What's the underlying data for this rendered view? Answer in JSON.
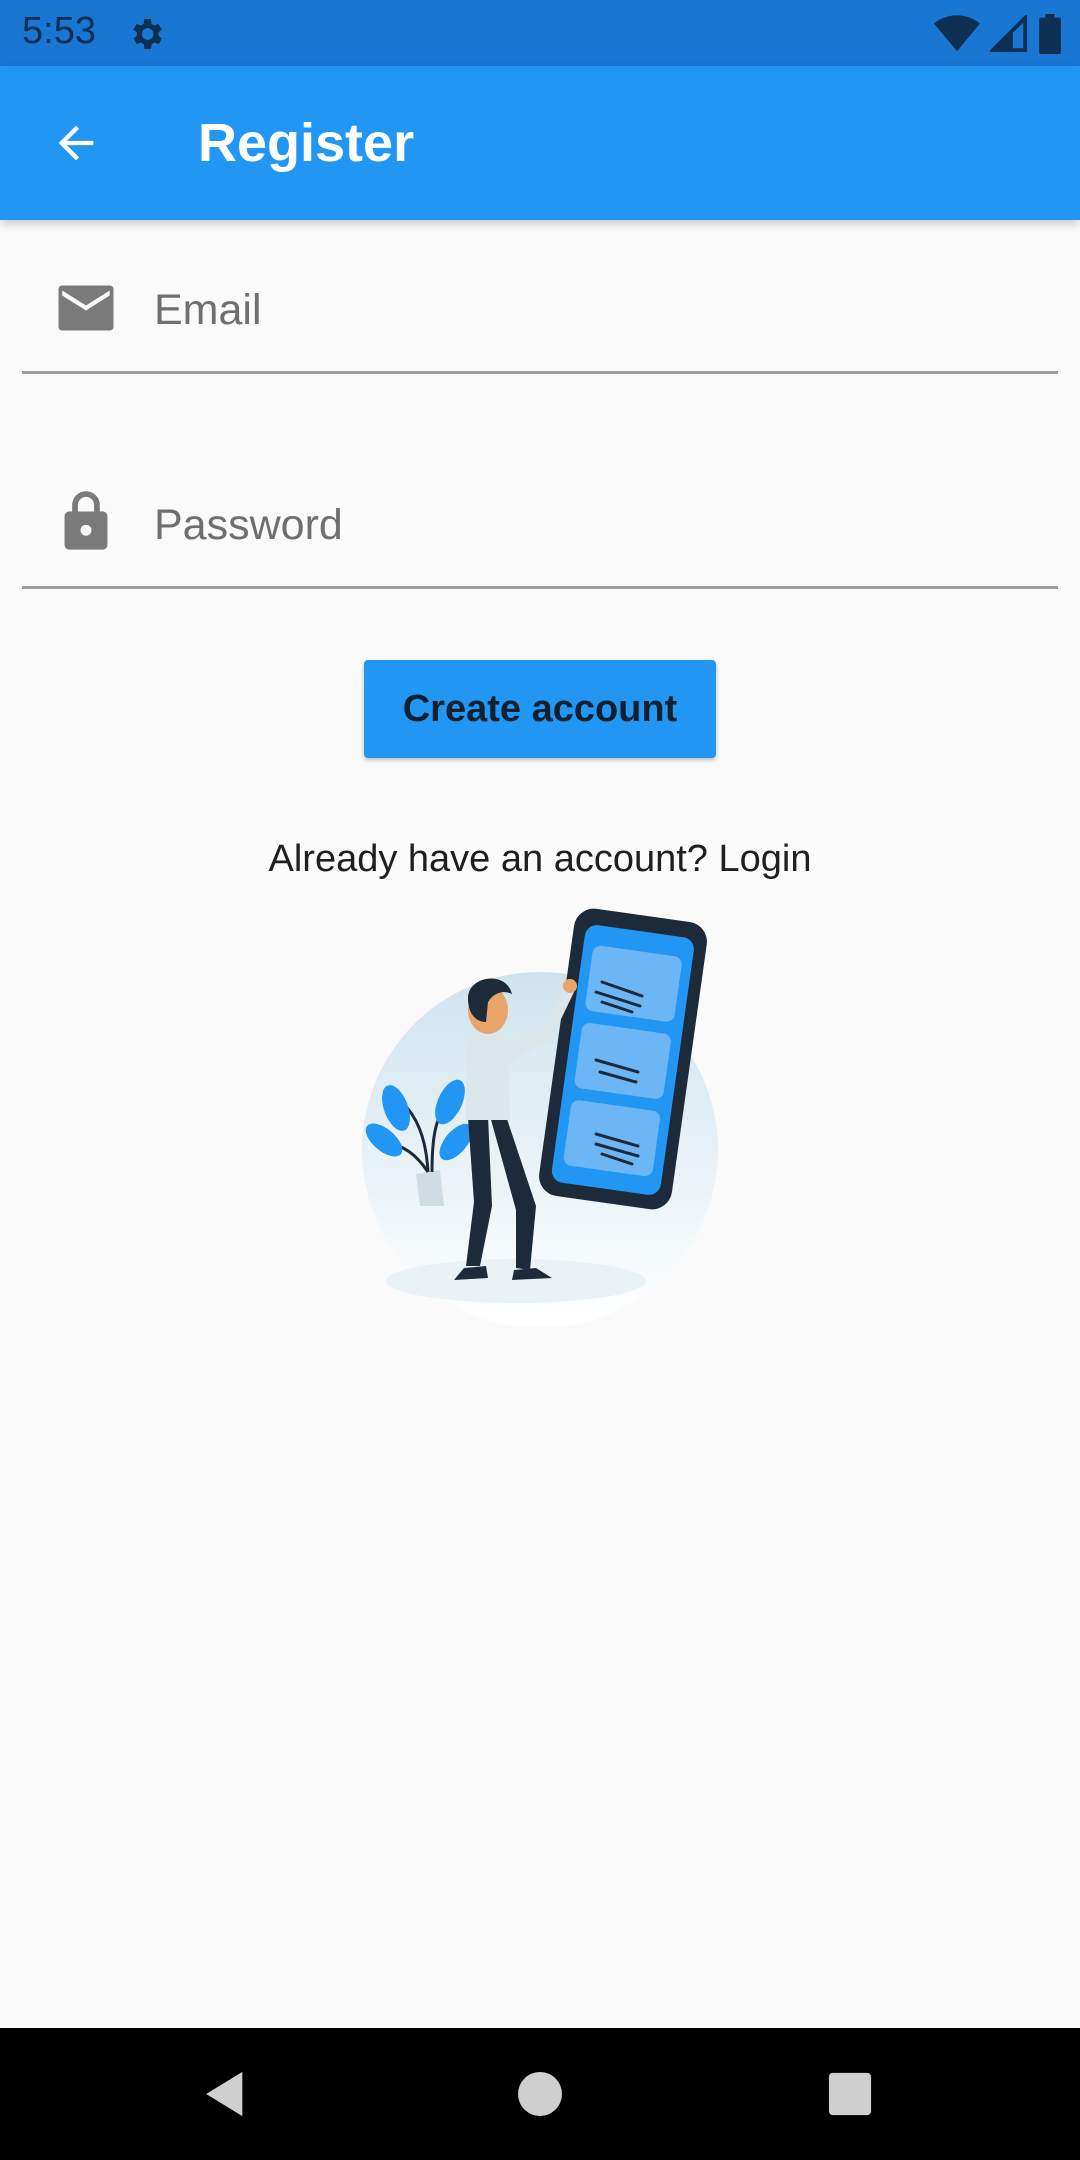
{
  "status_bar": {
    "time": "5:53",
    "icons": [
      "gear-icon",
      "wifi-icon",
      "signal-icon",
      "battery-icon"
    ]
  },
  "app_bar": {
    "title": "Register",
    "back_icon": "arrow-left-icon",
    "color": "#2196f3"
  },
  "form": {
    "email": {
      "placeholder": "Email",
      "value": "",
      "icon": "mail-icon"
    },
    "password": {
      "placeholder": "Password",
      "value": "",
      "icon": "lock-icon"
    }
  },
  "actions": {
    "create_account_label": "Create account",
    "login_prompt": "Already have an account? Login"
  },
  "nav_bar": {
    "icons": [
      "back-triangle-icon",
      "home-circle-icon",
      "recents-square-icon"
    ]
  },
  "colors": {
    "accent": "#2196f3",
    "status_bar": "#1976d2",
    "background": "#fafafa"
  }
}
